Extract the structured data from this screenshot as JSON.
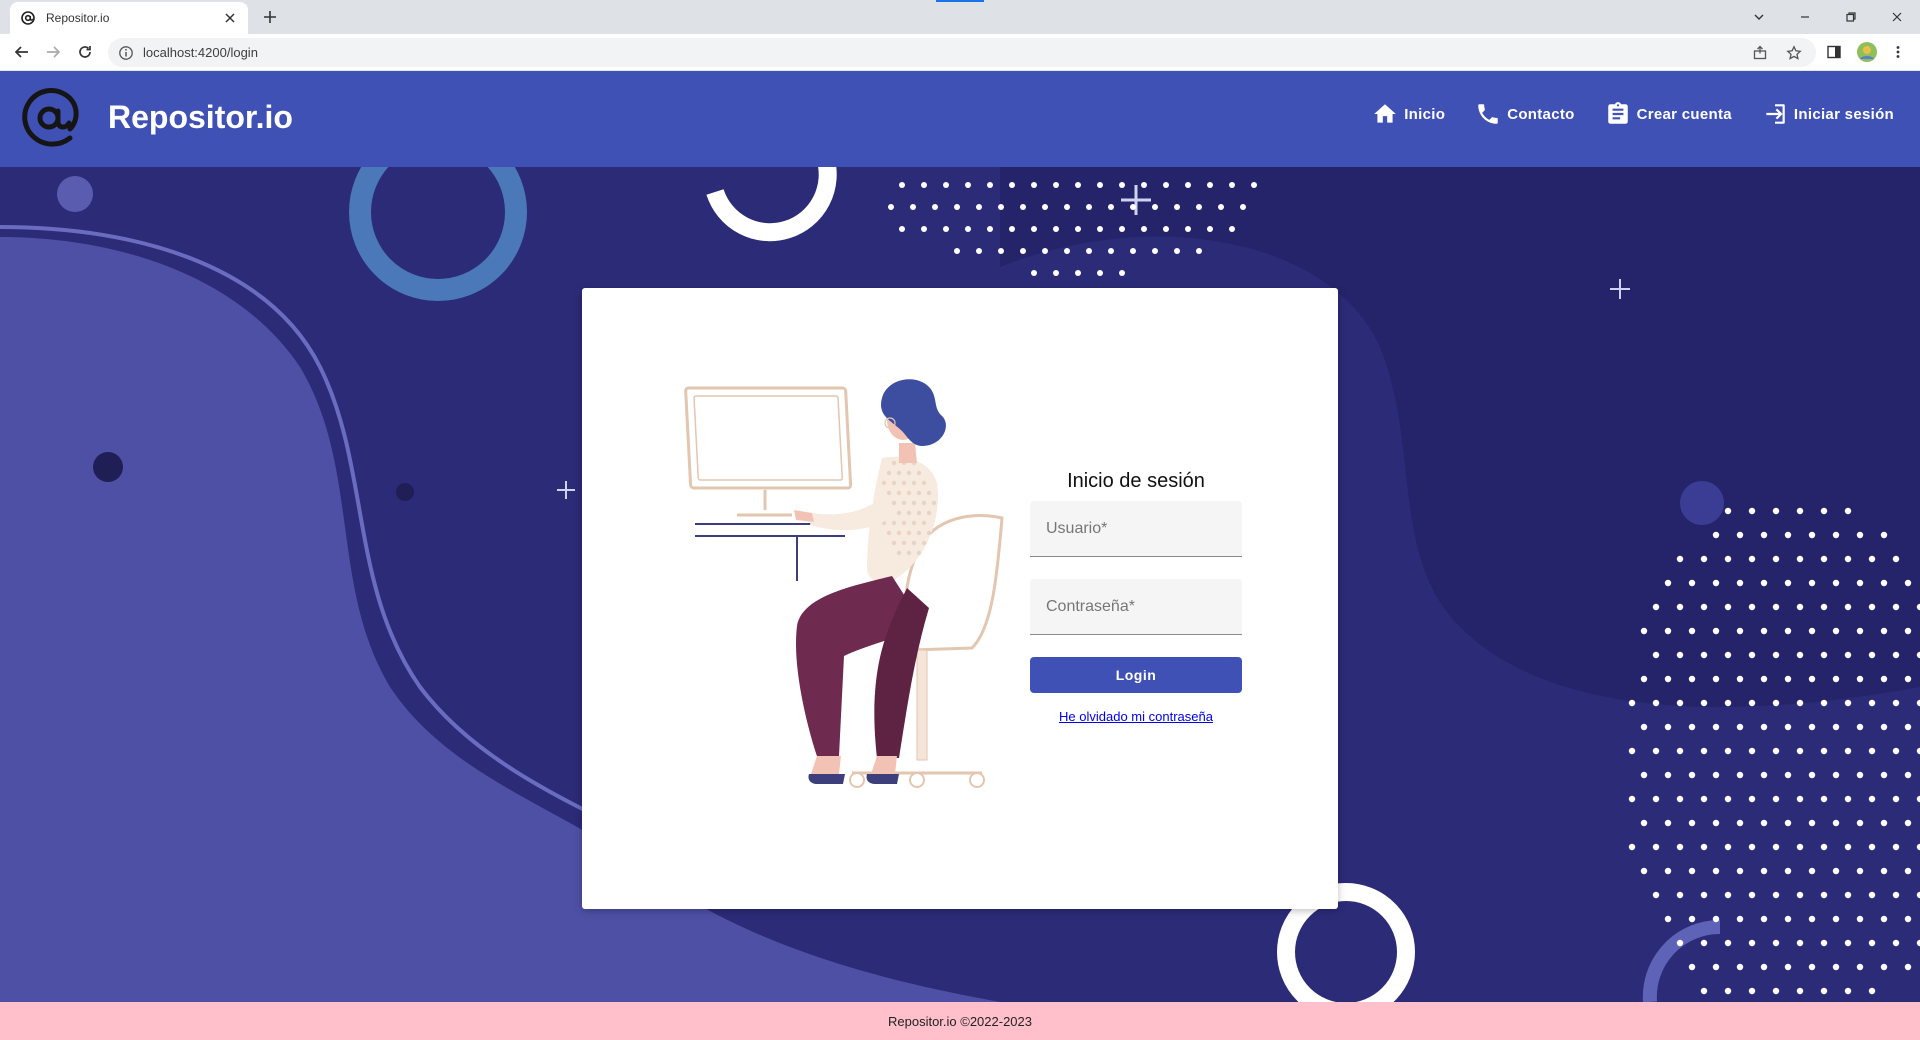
{
  "browser": {
    "tab_title": "Repositor.io",
    "url": "localhost:4200/login"
  },
  "header": {
    "brand": "Repositor.io",
    "nav": [
      {
        "label": "Inicio",
        "icon": "home-icon"
      },
      {
        "label": "Contacto",
        "icon": "phone-icon"
      },
      {
        "label": "Crear cuenta",
        "icon": "clipboard-icon"
      },
      {
        "label": "Iniciar sesión",
        "icon": "login-icon"
      }
    ]
  },
  "login": {
    "title": "Inicio de sesión",
    "username_placeholder": "Usuario*",
    "password_placeholder": "Contraseña*",
    "submit_label": "Login",
    "forgot_label": "He olvidado mi contraseña"
  },
  "footer": {
    "text": "Repositor.io ©2022-2023"
  },
  "colors": {
    "primary": "#3f51b5",
    "background": "#2c2b78",
    "footer": "#ffc0cb"
  }
}
